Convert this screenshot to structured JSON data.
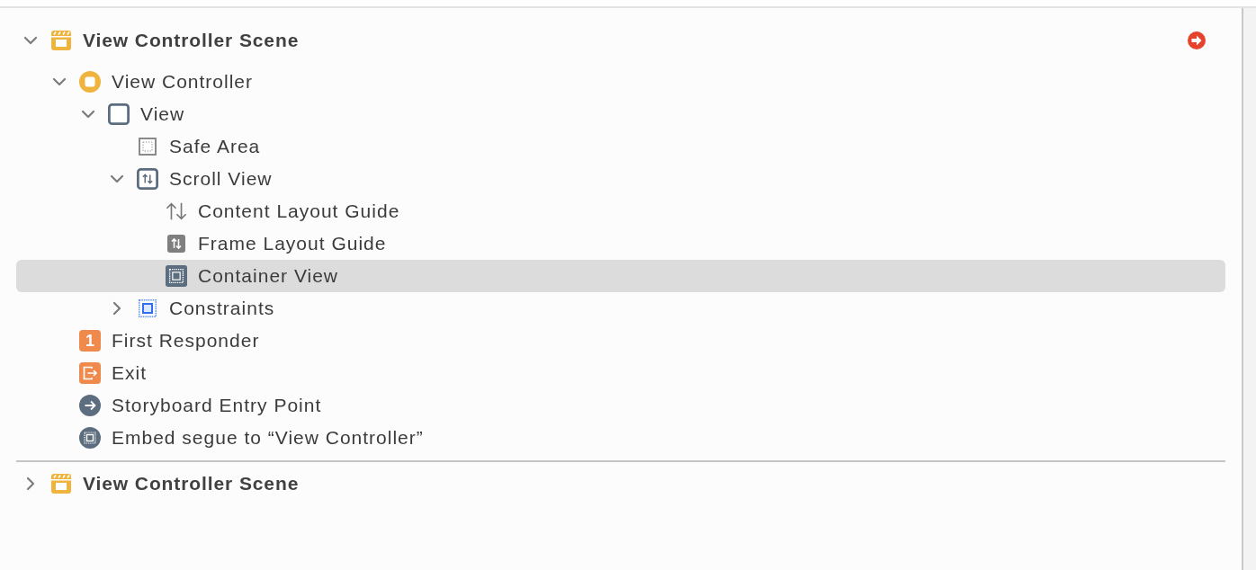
{
  "outline": {
    "scenes": [
      {
        "title": "View Controller Scene",
        "kind": "scene",
        "expanded": true,
        "selected": false,
        "issue": true,
        "children": [
          {
            "label": "View Controller",
            "kind": "view-controller",
            "expanded": true,
            "selected": false,
            "children": [
              {
                "label": "View",
                "kind": "view",
                "expanded": true,
                "selected": false,
                "children": [
                  {
                    "label": "Safe Area",
                    "kind": "safe-area",
                    "selected": false
                  },
                  {
                    "label": "Scroll View",
                    "kind": "scroll-view",
                    "expanded": true,
                    "selected": false,
                    "children": [
                      {
                        "label": "Content Layout Guide",
                        "kind": "content-layout-guide",
                        "selected": false
                      },
                      {
                        "label": "Frame Layout Guide",
                        "kind": "frame-layout-guide",
                        "selected": false
                      },
                      {
                        "label": "Container View",
                        "kind": "container-view",
                        "selected": true
                      }
                    ]
                  },
                  {
                    "label": "Constraints",
                    "kind": "constraints",
                    "expanded": false,
                    "selected": false
                  }
                ]
              }
            ]
          },
          {
            "label": "First Responder",
            "kind": "first-responder",
            "icon_glyph": "1",
            "selected": false
          },
          {
            "label": "Exit",
            "kind": "exit",
            "selected": false
          },
          {
            "label": "Storyboard Entry Point",
            "kind": "entry-point",
            "selected": false
          },
          {
            "label": "Embed segue to “View Controller”",
            "kind": "segue",
            "selected": false
          }
        ]
      },
      {
        "title": "View Controller Scene",
        "kind": "scene",
        "expanded": false,
        "selected": false,
        "issue": false
      }
    ]
  }
}
